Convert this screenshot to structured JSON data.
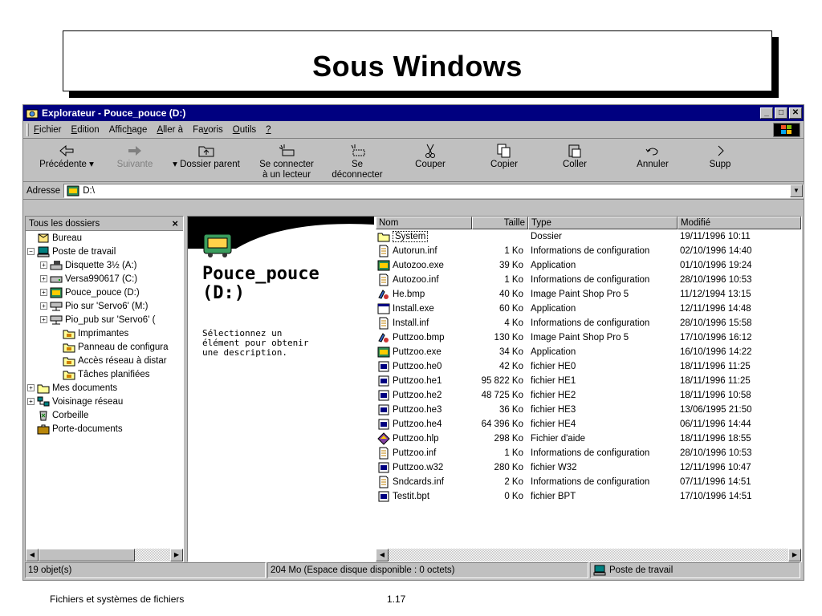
{
  "slide": {
    "title": "Sous Windows",
    "footer_left": "Fichiers et systèmes de fichiers",
    "page_number": "1.17"
  },
  "window": {
    "title": "Explorateur - Pouce_pouce (D:)",
    "minimize": "_",
    "maximize": "□",
    "close": "✕"
  },
  "menu": [
    {
      "pre": "",
      "u": "F",
      "post": "ichier"
    },
    {
      "pre": "",
      "u": "E",
      "post": "dition"
    },
    {
      "pre": "Affic",
      "u": "h",
      "post": "age"
    },
    {
      "pre": "",
      "u": "A",
      "post": "ller à"
    },
    {
      "pre": "Fa",
      "u": "v",
      "post": "oris"
    },
    {
      "pre": "",
      "u": "O",
      "post": "utils"
    },
    {
      "pre": "",
      "u": "?",
      "post": ""
    }
  ],
  "toolbar": {
    "back": "Précédente",
    "forward": "Suivante",
    "up": "Dossier parent",
    "connect_line1": "Se connecter",
    "connect_line2": "à un lecteur",
    "disconnect_line1": "Se",
    "disconnect_line2": "déconnecter",
    "cut": "Couper",
    "copy": "Copier",
    "paste": "Coller",
    "undo": "Annuler",
    "delete": "Supp"
  },
  "address": {
    "label": "Adresse",
    "value": "D:\\"
  },
  "tree": {
    "header": "Tous les dossiers",
    "close": "×",
    "items": [
      {
        "label": "Bureau",
        "indent": 0,
        "pm": "",
        "icon": "desktop"
      },
      {
        "label": "Poste de travail",
        "indent": 0,
        "pm": "−",
        "icon": "computer"
      },
      {
        "label": "Disquette 3½ (A:)",
        "indent": 1,
        "pm": "+",
        "icon": "floppy"
      },
      {
        "label": "Versa990617 (C:)",
        "indent": 1,
        "pm": "+",
        "icon": "harddisk"
      },
      {
        "label": "Pouce_pouce (D:)",
        "indent": 1,
        "pm": "+",
        "icon": "custom"
      },
      {
        "label": "Pio sur 'Servo6' (M:)",
        "indent": 1,
        "pm": "+",
        "icon": "netdrive"
      },
      {
        "label": "Pio_pub sur 'Servo6' (",
        "indent": 1,
        "pm": "+",
        "icon": "netdrive"
      },
      {
        "label": "Imprimantes",
        "indent": 2,
        "pm": "",
        "icon": "folder-special"
      },
      {
        "label": "Panneau de configura",
        "indent": 2,
        "pm": "",
        "icon": "folder-special"
      },
      {
        "label": "Accès réseau à distar",
        "indent": 2,
        "pm": "",
        "icon": "folder-special"
      },
      {
        "label": "Tâches planifiées",
        "indent": 2,
        "pm": "",
        "icon": "folder-special"
      },
      {
        "label": "Mes documents",
        "indent": 0,
        "pm": "+",
        "icon": "folder"
      },
      {
        "label": "Voisinage réseau",
        "indent": 0,
        "pm": "+",
        "icon": "network"
      },
      {
        "label": "Corbeille",
        "indent": 0,
        "pm": "",
        "icon": "recycle"
      },
      {
        "label": "Porte-documents",
        "indent": 0,
        "pm": "",
        "icon": "briefcase"
      }
    ]
  },
  "webview": {
    "drive_line1": "Pouce_pouce",
    "drive_line2": "(D:)",
    "description": "Sélectionnez un élément pour obtenir une description."
  },
  "columns": {
    "name": "Nom",
    "size": "Taille",
    "type": "Type",
    "modified": "Modifié"
  },
  "files": [
    {
      "name": "System",
      "size": "",
      "type": "Dossier",
      "modified": "19/11/1996 10:11",
      "icon": "folder"
    },
    {
      "name": "Autorun.inf",
      "size": "1 Ko",
      "type": "Informations de configuration",
      "modified": "02/10/1996 14:40",
      "icon": "inf"
    },
    {
      "name": "Autozoo.exe",
      "size": "39 Ko",
      "type": "Application",
      "modified": "01/10/1996 19:24",
      "icon": "custom"
    },
    {
      "name": "Autozoo.inf",
      "size": "1 Ko",
      "type": "Informations de configuration",
      "modified": "28/10/1996 10:53",
      "icon": "inf"
    },
    {
      "name": "He.bmp",
      "size": "40 Ko",
      "type": "Image Paint Shop Pro 5",
      "modified": "11/12/1994 13:15",
      "icon": "bmp"
    },
    {
      "name": "Install.exe",
      "size": "60 Ko",
      "type": "Application",
      "modified": "12/11/1996 14:48",
      "icon": "exe"
    },
    {
      "name": "Install.inf",
      "size": "4 Ko",
      "type": "Informations de configuration",
      "modified": "28/10/1996 15:58",
      "icon": "inf"
    },
    {
      "name": "Puttzoo.bmp",
      "size": "130 Ko",
      "type": "Image Paint Shop Pro 5",
      "modified": "17/10/1996 16:12",
      "icon": "bmp"
    },
    {
      "name": "Puttzoo.exe",
      "size": "34 Ko",
      "type": "Application",
      "modified": "16/10/1996 14:22",
      "icon": "custom"
    },
    {
      "name": "Puttzoo.he0",
      "size": "42 Ko",
      "type": "fichier HE0",
      "modified": "18/11/1996 11:25",
      "icon": "generic"
    },
    {
      "name": "Puttzoo.he1",
      "size": "95 822 Ko",
      "type": "fichier HE1",
      "modified": "18/11/1996 11:25",
      "icon": "generic"
    },
    {
      "name": "Puttzoo.he2",
      "size": "48 725 Ko",
      "type": "fichier HE2",
      "modified": "18/11/1996 10:58",
      "icon": "generic"
    },
    {
      "name": "Puttzoo.he3",
      "size": "36 Ko",
      "type": "fichier HE3",
      "modified": "13/06/1995 21:50",
      "icon": "generic"
    },
    {
      "name": "Puttzoo.he4",
      "size": "64 396 Ko",
      "type": "fichier HE4",
      "modified": "06/11/1996 14:44",
      "icon": "generic"
    },
    {
      "name": "Puttzoo.hlp",
      "size": "298 Ko",
      "type": "Fichier d'aide",
      "modified": "18/11/1996 18:55",
      "icon": "help"
    },
    {
      "name": "Puttzoo.inf",
      "size": "1 Ko",
      "type": "Informations de configuration",
      "modified": "28/10/1996 10:53",
      "icon": "inf"
    },
    {
      "name": "Puttzoo.w32",
      "size": "280 Ko",
      "type": "fichier W32",
      "modified": "12/11/1996 10:47",
      "icon": "generic"
    },
    {
      "name": "Sndcards.inf",
      "size": "2 Ko",
      "type": "Informations de configuration",
      "modified": "07/11/1996 14:51",
      "icon": "inf"
    },
    {
      "name": "Testit.bpt",
      "size": "0 Ko",
      "type": "fichier BPT",
      "modified": "17/10/1996 14:51",
      "icon": "generic"
    }
  ],
  "status": {
    "count": "19 objet(s)",
    "space": "204 Mo (Espace disque disponible : 0 octets)",
    "zone": "Poste de travail"
  },
  "colors": {
    "titlebar": "#000080",
    "face": "#c0c0c0",
    "folder": "#ffff99"
  }
}
